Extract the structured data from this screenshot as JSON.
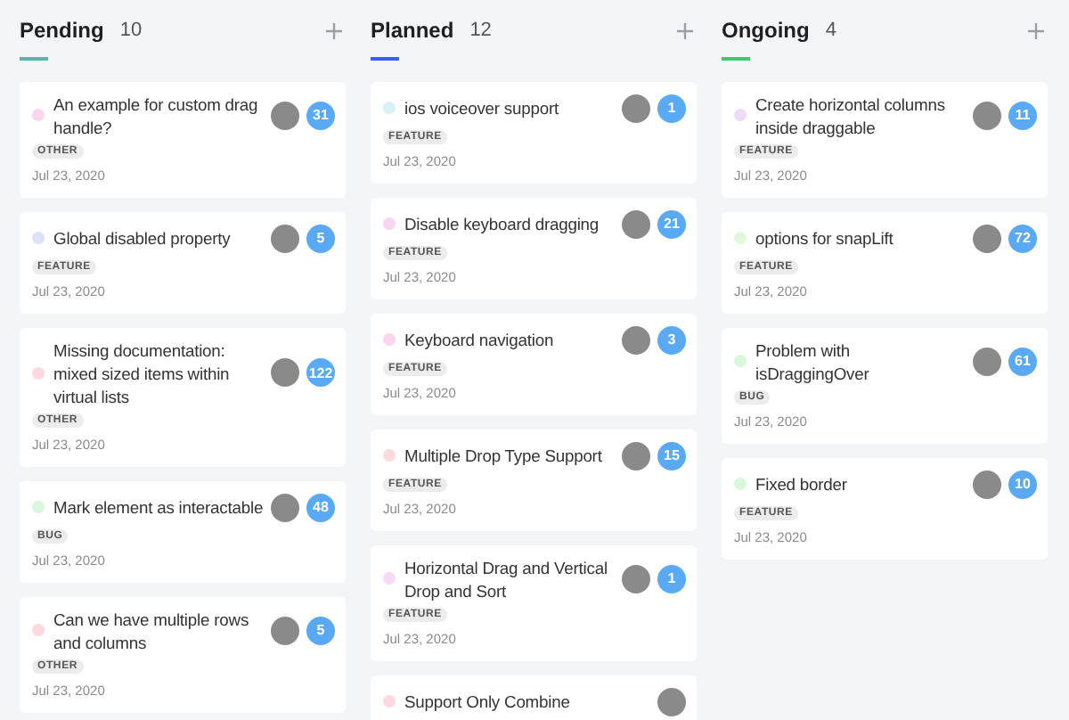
{
  "columns": [
    {
      "title": "Pending",
      "count": "10",
      "color": "#5bb5a8",
      "cards": [
        {
          "title": "An example for custom drag handle?",
          "tag": "OTHER",
          "date": "Jul 23, 2020",
          "count": "31",
          "color": "#f9d6ee"
        },
        {
          "title": "Global disabled property",
          "tag": "FEATURE",
          "date": "Jul 23, 2020",
          "count": "5",
          "color": "#dde2f8"
        },
        {
          "title": "Missing documentation: mixed sized items within virtual lists",
          "tag": "OTHER",
          "date": "Jul 23, 2020",
          "count": "122",
          "color": "#fbd9df"
        },
        {
          "title": "Mark element as interactable",
          "tag": "BUG",
          "date": "Jul 23, 2020",
          "count": "48",
          "color": "#d9f7da"
        },
        {
          "title": "Can we have multiple rows and columns",
          "tag": "OTHER",
          "date": "Jul 23, 2020",
          "count": "5",
          "color": "#fbd9df"
        }
      ]
    },
    {
      "title": "Planned",
      "count": "12",
      "color": "#3d5afe",
      "cards": [
        {
          "title": "ios voiceover support",
          "tag": "FEATURE",
          "date": "Jul 23, 2020",
          "count": "1",
          "color": "#d9f1f6"
        },
        {
          "title": "Disable keyboard dragging",
          "tag": "FEATURE",
          "date": "Jul 23, 2020",
          "count": "21",
          "color": "#f9d6ee"
        },
        {
          "title": "Keyboard navigation",
          "tag": "FEATURE",
          "date": "Jul 23, 2020",
          "count": "3",
          "color": "#f9d6ee"
        },
        {
          "title": "Multiple Drop Type Support",
          "tag": "FEATURE",
          "date": "Jul 23, 2020",
          "count": "15",
          "color": "#fbd9df"
        },
        {
          "title": "Horizontal Drag and Vertical Drop and Sort",
          "tag": "FEATURE",
          "date": "Jul 23, 2020",
          "count": "1",
          "color": "#f3d9f4"
        },
        {
          "title": "Support Only Combine",
          "color": "#fbd9df"
        }
      ]
    },
    {
      "title": "Ongoing",
      "count": "4",
      "color": "#3cc86b",
      "cards": [
        {
          "title": "Create horizontal columns inside draggable",
          "tag": "FEATURE",
          "date": "Jul 23, 2020",
          "count": "11",
          "color": "#ecdcf7"
        },
        {
          "title": "options for snapLift",
          "tag": "FEATURE",
          "date": "Jul 23, 2020",
          "count": "72",
          "color": "#e2f8dc"
        },
        {
          "title": "Problem with isDraggingOver",
          "tag": "BUG",
          "date": "Jul 23, 2020",
          "count": "61",
          "color": "#d9f7da"
        },
        {
          "title": "Fixed border",
          "tag": "FEATURE",
          "date": "Jul 23, 2020",
          "count": "10",
          "color": "#d9f7da"
        }
      ]
    }
  ]
}
